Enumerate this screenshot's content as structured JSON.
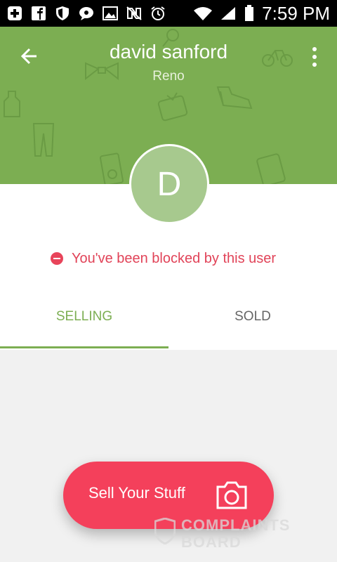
{
  "status_bar": {
    "time": "7:59 PM",
    "icons": [
      "plus-icon",
      "facebook-icon",
      "shield-icon",
      "chat-icon",
      "image-icon",
      "nfc-icon",
      "alarm-icon",
      "wifi-icon",
      "signal-icon",
      "battery-icon"
    ]
  },
  "profile": {
    "name": "david sanford",
    "city": "Reno",
    "avatar_initial": "D"
  },
  "blocked_message": "You've been blocked by this user",
  "tabs": [
    {
      "label": "SELLING",
      "active": true
    },
    {
      "label": "SOLD",
      "active": false
    }
  ],
  "fab": {
    "label": "Sell Your Stuff",
    "icon": "camera-icon"
  },
  "watermark": {
    "line1": "COMPLAINTS",
    "line2": "BOARD"
  },
  "colors": {
    "header_green": "#7cae52",
    "avatar_green": "#a7c98e",
    "accent_red": "#f4405b",
    "blocked_red": "#e14358"
  }
}
